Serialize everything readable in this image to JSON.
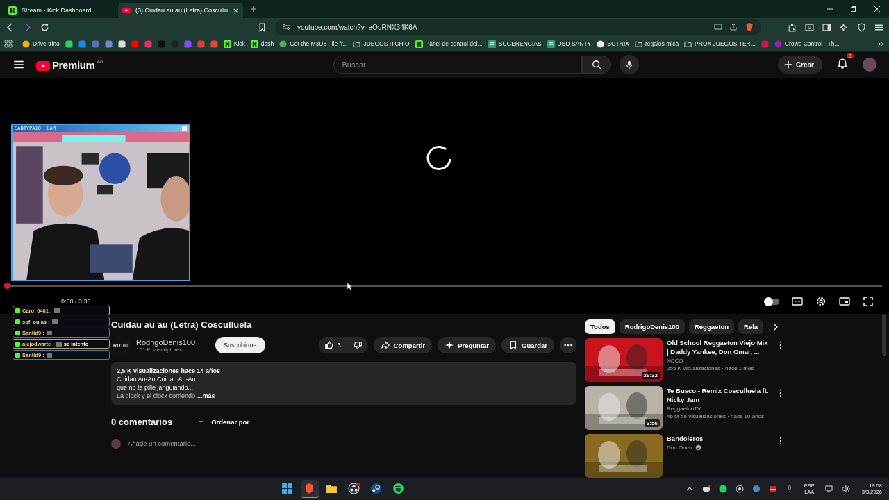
{
  "browser": {
    "tabs": [
      {
        "title": "Stream - Kick Dashboard",
        "kind": "kick",
        "selected": false
      },
      {
        "title": "(3) Cuidau au au (Letra) Coscullu",
        "kind": "youtube",
        "selected": true
      }
    ],
    "url": "youtube.com/watch?v=eOuRNX34K6A",
    "bookmarks": [
      {
        "label": "Drive trino",
        "kind": "site",
        "color": "#f4b400"
      },
      {
        "kind": "site",
        "color": "#25d366"
      },
      {
        "kind": "site",
        "color": "#1e88e5"
      },
      {
        "kind": "site",
        "color": "#5c6bc0"
      },
      {
        "kind": "site",
        "color": "#7986cb"
      },
      {
        "kind": "site",
        "color": "#dddddd"
      },
      {
        "kind": "site",
        "color": "#ff0000"
      },
      {
        "kind": "site",
        "color": "#e1306c"
      },
      {
        "kind": "site",
        "color": "#111111"
      },
      {
        "kind": "site",
        "color": "#222222"
      },
      {
        "kind": "site",
        "color": "#9146ff"
      },
      {
        "kind": "site",
        "color": "#e53935"
      },
      {
        "kind": "site",
        "color": "#ea4335"
      },
      {
        "label": "Kick",
        "kind": "kick"
      },
      {
        "label": "dash",
        "kind": "kick"
      },
      {
        "label": "Get the M3U8 File fr...",
        "kind": "site",
        "color": "#4caf50"
      },
      {
        "label": "JUEGOS ITCHIO",
        "kind": "folder"
      },
      {
        "label": "Panel de control del...",
        "kind": "kick"
      },
      {
        "label": "SUGERENCIAS",
        "kind": "sheet"
      },
      {
        "label": "DBD SANTY",
        "kind": "sheet"
      },
      {
        "label": "BOTRIX",
        "kind": "site",
        "color": "#eeeeee"
      },
      {
        "label": "regalos mica",
        "kind": "folder"
      },
      {
        "label": "PROX JUEGOS TER...",
        "kind": "folder"
      },
      {
        "kind": "site",
        "color": "#c2185b"
      },
      {
        "label": "Crowd Control - Th...",
        "kind": "site",
        "color": "#8e24aa"
      }
    ]
  },
  "header": {
    "logo": "Premium",
    "region": "AR",
    "search_placeholder": "Buscar",
    "create": "Crear",
    "notifications": "3"
  },
  "player": {
    "time": "0:00 / 3:33",
    "level": 0,
    "autoplay": false
  },
  "cam": {
    "title": "SANTYPA10  CAM"
  },
  "chat": [
    {
      "user": "Caro_0401 :",
      "color": "#f2c230"
    },
    {
      "user": "sof_oulas :",
      "color": "#a64bd6"
    },
    {
      "user": "Santid9 :",
      "color": "#3a7bd5"
    },
    {
      "user": "alejodwarte :",
      "color": "#d9a520",
      "message": "se intento"
    },
    {
      "user": "Santid9 :",
      "color": "#3a7bd5"
    }
  ],
  "video": {
    "title": "Cuidau au au (Letra) Cosculluela",
    "channel": "RodrigoDenis100",
    "channel_badge": "RD100",
    "subscribers": "101 K suscriptores",
    "subscribe": "Suscribirme",
    "likes": "3",
    "actions": [
      {
        "label": "Compartir",
        "kind": "share"
      },
      {
        "label": "Preguntar",
        "kind": "ask"
      },
      {
        "label": "Guardar",
        "kind": "save"
      }
    ],
    "stats": "2,5 K visualizaciones  hace 14 años",
    "description": [
      "Cuidau Au-Au,Cuidau Au-Au",
      "que no te pille janguiando...",
      "La glock y el clock corriendo"
    ],
    "more": "...más",
    "comments": "0 comentarios",
    "sort": "Ordenar por",
    "comment_placeholder": "Añade un comentario..."
  },
  "chips": [
    {
      "label": "Todos",
      "selected": true
    },
    {
      "label": "RodrigoDenis100",
      "selected": false
    },
    {
      "label": "Reggaeton",
      "selected": false
    },
    {
      "label": "Rela",
      "selected": false
    }
  ],
  "recommendations": [
    {
      "title": "Old School Reggaeton Viejo Mix | Daddy Yankee, Don Omar, ...",
      "channel": "XOCO",
      "meta": "255 K visualizaciones · hace 1 mes",
      "duration": "29:32",
      "color": "#c8141e",
      "verified": false
    },
    {
      "title": "Te Busco - Remix Cosculluela ft. Nicky Jam",
      "channel": "ReggaetonTV",
      "meta": "46 M de visualizaciones · hace 10 años",
      "duration": "3:56",
      "color": "#b9b2a6",
      "verified": false
    },
    {
      "title": "Bandoleros",
      "channel": "Don Omar",
      "color": "#8a6a20",
      "verified": true
    }
  ],
  "taskbar": {
    "apps": [
      {
        "kind": "windows",
        "selected": false
      },
      {
        "kind": "brave",
        "selected": true
      },
      {
        "kind": "folder",
        "selected": false
      },
      {
        "kind": "obs",
        "selected": false
      },
      {
        "kind": "steam",
        "selected": false
      },
      {
        "kind": "spotify",
        "selected": false
      }
    ],
    "language": "ESP",
    "layout": "LAA",
    "time": "19:58",
    "date": "3/3/2026"
  }
}
